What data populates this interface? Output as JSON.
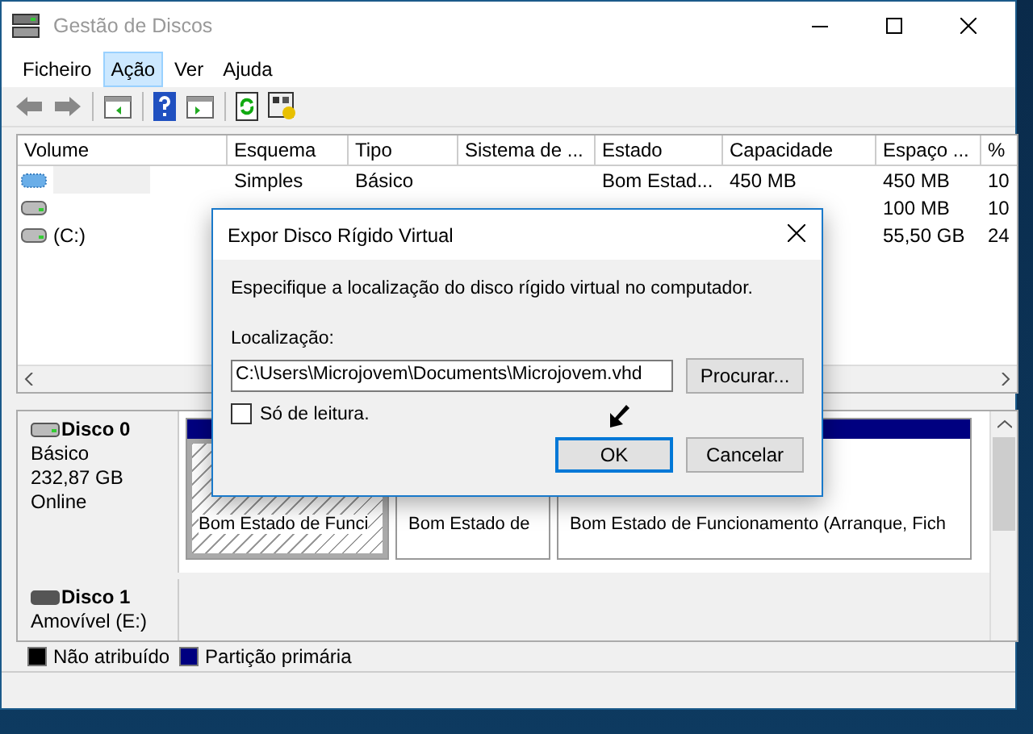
{
  "window": {
    "title": "Gestão de Discos"
  },
  "menu": [
    {
      "label": "Ficheiro",
      "selected": false
    },
    {
      "label": "Ação",
      "selected": true
    },
    {
      "label": "Ver",
      "selected": false
    },
    {
      "label": "Ajuda",
      "selected": false
    }
  ],
  "volumes": {
    "columns": [
      "Volume",
      "Esquema",
      "Tipo",
      "Sistema de ...",
      "Estado",
      "Capacidade",
      "Espaço ...",
      "%"
    ],
    "rows": [
      {
        "selected": true,
        "cells": [
          null,
          "Simples",
          "Básico",
          null,
          "Bom Estad...",
          "450 MB",
          "450 MB",
          "10"
        ]
      },
      {
        "selected": false,
        "cells": [
          null,
          null,
          null,
          null,
          null,
          null,
          "100 MB",
          "10"
        ]
      },
      {
        "selected": false,
        "cells": [
          "(C:)",
          null,
          null,
          null,
          null,
          null,
          "55,50 GB",
          "24"
        ]
      }
    ]
  },
  "disks": [
    {
      "name": "Disco 0",
      "kind": "fixed",
      "lines": [
        "Básico",
        "232,87 GB",
        "Online"
      ],
      "partitions": [
        {
          "kind": "primary",
          "selected": true,
          "status": "Bom Estado de Funci"
        },
        {
          "kind": "primary",
          "selected": false,
          "status": "Bom Estado de"
        },
        {
          "kind": "primary",
          "selected": false,
          "status": "Bom Estado de Funcionamento (Arranque, Fich"
        }
      ]
    },
    {
      "name": "Disco 1",
      "kind": "removable",
      "lines": [
        "Amovível (E:)"
      ]
    }
  ],
  "legend": [
    {
      "label": "Não atribuído",
      "color": "#000000"
    },
    {
      "label": "Partição primária",
      "color": "#000080"
    }
  ],
  "dialog": {
    "title": "Expor Disco Rígido Virtual",
    "instruction": "Especifique a localização do disco rígido virtual no computador.",
    "location_label": "Localização:",
    "location_value": "C:\\Users\\Microjovem\\Documents\\Microjovem.vhd",
    "browse_button": "Procurar...",
    "read_only": {
      "label": "Só de leitura.",
      "checked": false
    },
    "buttons": [
      {
        "label": "OK",
        "default": true
      },
      {
        "label": "Cancelar",
        "default": false
      }
    ]
  }
}
